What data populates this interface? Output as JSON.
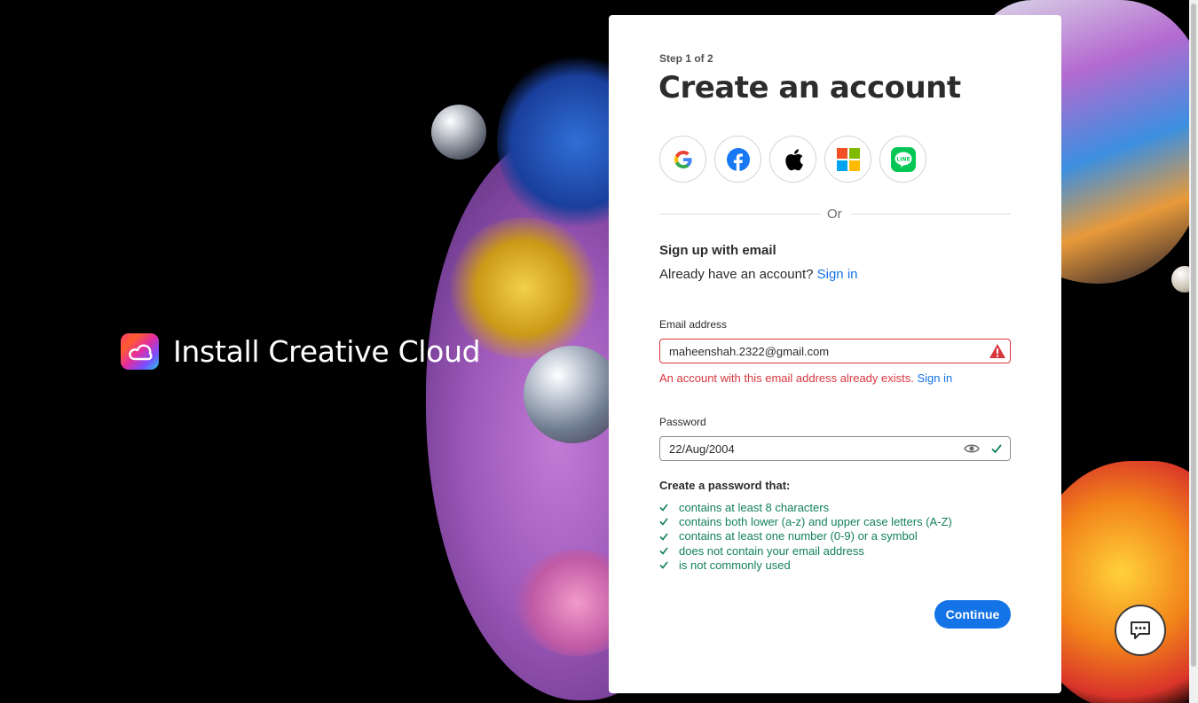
{
  "brand": {
    "text": "Install Creative Cloud",
    "logo_icon": "creative-cloud-logo-icon"
  },
  "form": {
    "step": "Step 1 of 2",
    "title": "Create an account",
    "social_buttons": [
      {
        "name": "google",
        "icon": "google-icon"
      },
      {
        "name": "facebook",
        "icon": "facebook-icon"
      },
      {
        "name": "apple",
        "icon": "apple-icon"
      },
      {
        "name": "microsoft",
        "icon": "microsoft-icon"
      },
      {
        "name": "line",
        "icon": "line-icon"
      }
    ],
    "divider_text": "Or",
    "signup_heading": "Sign up with email",
    "have_account_text": "Already have an account?",
    "sign_in_link": "Sign in",
    "email": {
      "label": "Email address",
      "value": "maheenshah.2322@gmail.com",
      "error": "An account with this email address already exists.",
      "error_link": "Sign in"
    },
    "password": {
      "label": "Password",
      "value": "22/Aug/2004"
    },
    "requirements_title": "Create a password that:",
    "requirements": [
      "contains at least 8 characters",
      "contains both lower (a-z) and upper case letters (A-Z)",
      "contains at least one number (0-9) or a symbol",
      "does not contain your email address",
      "is not commonly used"
    ],
    "continue_label": "Continue"
  },
  "colors": {
    "accent": "#1473e6",
    "error": "#d7373f",
    "success": "#12805c"
  }
}
